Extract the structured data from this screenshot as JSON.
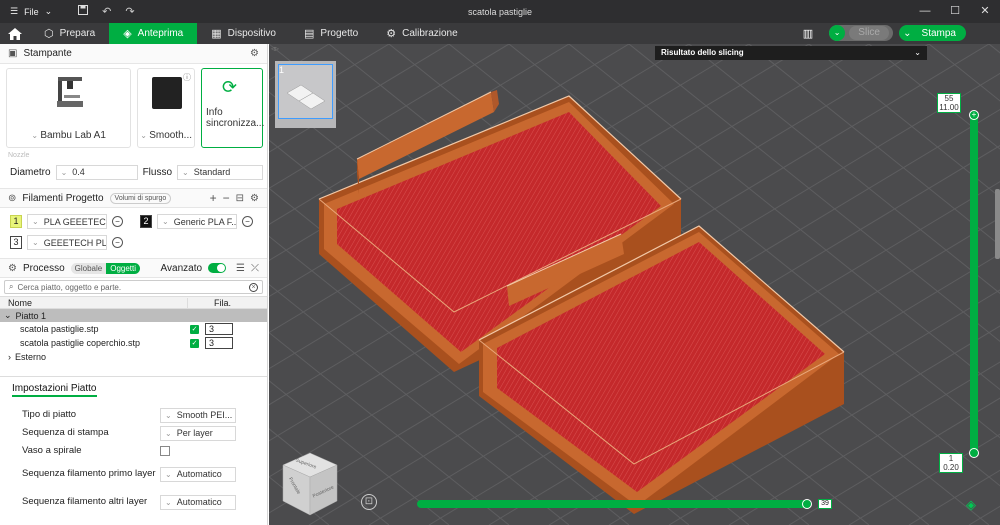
{
  "window": {
    "file_menu": "File",
    "title": "scatola pastiglie",
    "controls": [
      "—",
      "☐",
      "✕"
    ]
  },
  "tabs": [
    {
      "label": "Prepara",
      "icon": "prepare-icon"
    },
    {
      "label": "Anteprima",
      "icon": "preview-icon",
      "active": true
    },
    {
      "label": "Dispositivo",
      "icon": "device-icon"
    },
    {
      "label": "Progetto",
      "icon": "project-icon"
    },
    {
      "label": "Calibrazione",
      "icon": "calibration-icon"
    }
  ],
  "toolbar": {
    "slice_label": "Slice",
    "print_label": "Stampa"
  },
  "printer": {
    "header": "Stampante",
    "printer_name": "Bambu Lab A1",
    "plate_type": "Smooth...",
    "sync_label_1": "Info",
    "sync_label_2": "sincronizza...",
    "nozzle_label": "Nozzle",
    "diameter_label": "Diametro",
    "diameter_value": "0.4",
    "flow_label": "Flusso",
    "flow_value": "Standard"
  },
  "filaments": {
    "header": "Filamenti Progetto",
    "flush_label": "Volumi di spurgo",
    "items": [
      {
        "num": "1",
        "name": "PLA GEEETEC...",
        "swatch": "#e8f57a"
      },
      {
        "num": "2",
        "name": "Generic PLA F...",
        "swatch": "#111111"
      },
      {
        "num": "3",
        "name": "GEEETECH PL...",
        "swatch": "#ffffff"
      }
    ]
  },
  "process": {
    "header": "Processo",
    "global_label": "Globale",
    "objects_label": "Oggetti",
    "advanced_label": "Avanzato",
    "search_placeholder": "Cerca piatto, oggetto e parte.",
    "col_name": "Nome",
    "col_fil": "Fila.",
    "plate_label": "Piatto 1",
    "objects": [
      {
        "name": "scatola pastiglie.stp",
        "fil": "3"
      },
      {
        "name": "scatola pastiglie coperchio.stp",
        "fil": "3"
      }
    ],
    "external_label": "Esterno"
  },
  "plate_settings": {
    "header": "Impostazioni Piatto",
    "rows": [
      {
        "key": "Tipo di piatto",
        "value": "Smooth PEI..."
      },
      {
        "key": "Sequenza di stampa",
        "value": "Per layer"
      },
      {
        "key": "Vaso a spirale",
        "value": ""
      },
      {
        "key": "Sequenza filamento primo layer",
        "value": "Automatico"
      },
      {
        "key": "Sequenza filamento altri layer",
        "value": "Automatico"
      }
    ]
  },
  "viewport": {
    "thumb_number": "1",
    "result_label": "Risultato dello slicing",
    "layer_top_a": "55",
    "layer_top_b": "11.00",
    "layer_bottom_a": "1",
    "layer_bottom_b": "0.20",
    "move_value": "39",
    "cube_faces": [
      "Superiore",
      "Frontale",
      "Posteriore"
    ],
    "colors": {
      "model": "#c8682f",
      "infill": "#c4292b",
      "accent": "#00ae42"
    }
  }
}
